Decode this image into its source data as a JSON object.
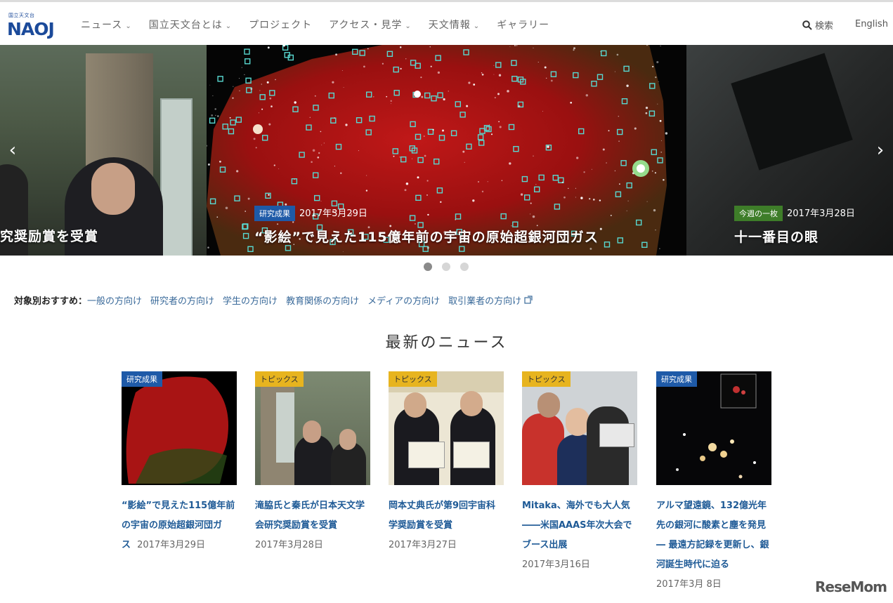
{
  "header": {
    "logo_small": "国立天文台",
    "logo_text": "NAOJ",
    "nav": [
      {
        "label": "ニュース",
        "dropdown": true
      },
      {
        "label": "国立天文台とは",
        "dropdown": true
      },
      {
        "label": "プロジェクト",
        "dropdown": false
      },
      {
        "label": "アクセス・見学",
        "dropdown": true
      },
      {
        "label": "天文情報",
        "dropdown": true
      },
      {
        "label": "ギャラリー",
        "dropdown": false
      }
    ],
    "search_label": "検索",
    "lang_label": "English"
  },
  "hero": {
    "left_title": "究奨励賞を受賞",
    "main": {
      "tag": "研究成果",
      "date": "2017年3月29日",
      "title": "“影絵”で見えた115億年前の宇宙の原始超銀河団ガス"
    },
    "right": {
      "tag": "今週の一枚",
      "date": "2017年3月28日",
      "title": "十一番目の眼"
    },
    "prev_arrow": "‹",
    "next_arrow": "›",
    "dots": 3,
    "active_dot": 0
  },
  "audience": {
    "label": "対象別おすすめ：",
    "links": [
      "一般の方向け",
      "研究者の方向け",
      "学生の方向け",
      "教育関係の方向け",
      "メディアの方向け",
      "取引業者の方向け"
    ]
  },
  "news": {
    "heading": "最新のニュース",
    "items": [
      {
        "tag": "研究成果",
        "title": "“影絵”で見えた115億年前の宇宙の原始超銀河団ガス",
        "date": "2017年3月29日"
      },
      {
        "tag": "トピックス",
        "title": "滝脇氏と秦氏が日本天文学会研究奨励賞を受賞",
        "date": "2017年3月28日"
      },
      {
        "tag": "トピックス",
        "title": "岡本丈典氏が第9回宇宙科学奨励賞を受賞",
        "date": "2017年3月27日"
      },
      {
        "tag": "トピックス",
        "title": "Mitaka、海外でも大人気――米国AAAS年次大会でブース出展",
        "date": "2017年3月16日"
      },
      {
        "tag": "研究成果",
        "title": "アルマ望遠鏡、132億光年先の銀河に酸素と塵を発見 ― 最遠方記録を更新し、銀河誕生時代に迫る",
        "date": "2017年3月 8日"
      }
    ]
  },
  "watermark": "ReseMom",
  "colors": {
    "accent_blue": "#1e5aa8",
    "tag_yellow": "#e7b41f",
    "tag_green": "#3e7d29",
    "link": "#1e5a96"
  }
}
